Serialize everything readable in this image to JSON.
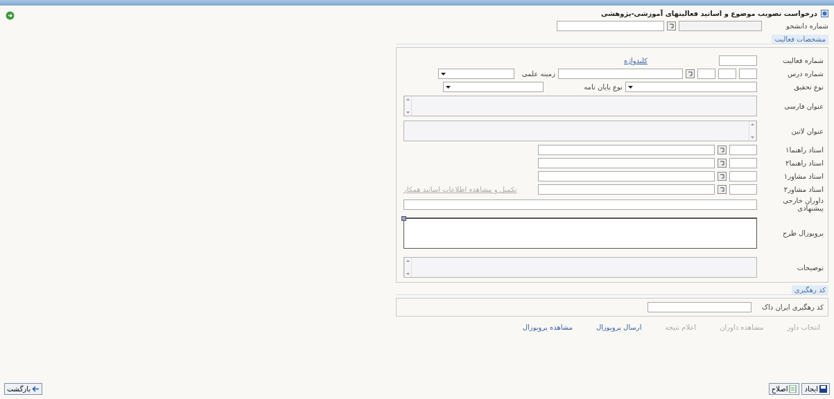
{
  "window": {
    "title": "درخواست تصویب موضوع و اساتید فعالیتهای آموزشی-پژوهشی"
  },
  "student": {
    "label": "شماره دانشجو"
  },
  "activity_section": {
    "title": "مشخصات فعالیت"
  },
  "fields": [
    {
      "kind": "activity",
      "label": "شماره فعالیت",
      "link": "کلیدواژه"
    },
    {
      "kind": "course",
      "label": "شماره درس",
      "second_label": "زمینه علمی"
    },
    {
      "kind": "selects",
      "label": "نوع تحقیق",
      "second_label": "نوع پایان نامه"
    },
    {
      "kind": "memo",
      "label": "عنوان فارسی"
    },
    {
      "kind": "memo_ltr",
      "label": "عنوان لاتین"
    },
    {
      "kind": "person",
      "label": "استاد راهنما۱"
    },
    {
      "kind": "person",
      "label": "استاد راهنما۲"
    },
    {
      "kind": "person",
      "label": "استاد مشاور۱"
    },
    {
      "kind": "person",
      "label": "استاد مشاور۲",
      "link": "تکمیل و مشاهده اطلاعات اساتید همکار"
    },
    {
      "kind": "wide",
      "label": "داوران خارجی پیشنهادی"
    },
    {
      "kind": "editor",
      "label": "پروپوزال طرح"
    },
    {
      "kind": "memo",
      "label": "توضیحات"
    }
  ],
  "tracking_section": {
    "title": "کد رهگیری",
    "label": "کد رهگیری ایران داک"
  },
  "links": [
    {
      "label": "انتخاب داور",
      "disabled": true
    },
    {
      "label": "مشاهده داوران",
      "disabled": true
    },
    {
      "label": "اعلام نتیجه",
      "disabled": true
    },
    {
      "label": "ارسال پروپوزال",
      "disabled": false
    },
    {
      "label": "مشاهده پروپوزال",
      "disabled": false
    }
  ],
  "footer": {
    "right_buttons": [
      {
        "kind": "save",
        "label": "ایجاد"
      },
      {
        "kind": "edit",
        "label": "اصلاح"
      }
    ],
    "left_button": {
      "label": "بازگشت"
    }
  }
}
